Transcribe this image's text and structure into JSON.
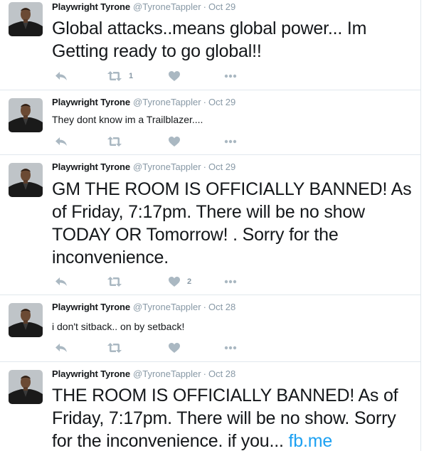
{
  "colors": {
    "name": "#14171a",
    "meta": "#8899a6",
    "icon": "#aab8c2",
    "link": "#1da1f2",
    "divider": "#e1e8ed"
  },
  "tweets": [
    {
      "name": "Playwright Tyrone",
      "handle": "@TyroneTappler",
      "separator": "·",
      "time": "Oct 29",
      "text": "Global attacks..means global power... Im Getting ready to go global!!",
      "link": "",
      "retweets": "1",
      "likes": ""
    },
    {
      "name": "Playwright Tyrone",
      "handle": "@TyroneTappler",
      "separator": "·",
      "time": "Oct 29",
      "text": "They dont know im a Trailblazer....",
      "link": "",
      "retweets": "",
      "likes": ""
    },
    {
      "name": "Playwright Tyrone",
      "handle": "@TyroneTappler",
      "separator": "·",
      "time": "Oct 29",
      "text": "GM THE ROOM IS OFFICIALLY BANNED! As of Friday, 7:17pm. There will be no show TODAY OR Tomorrow! . Sorry for the inconvenience.",
      "link": "",
      "retweets": "",
      "likes": "2"
    },
    {
      "name": "Playwright Tyrone",
      "handle": "@TyroneTappler",
      "separator": "·",
      "time": "Oct 28",
      "text": "i don't sitback.. on by setback!",
      "link": "",
      "retweets": "",
      "likes": ""
    },
    {
      "name": "Playwright Tyrone",
      "handle": "@TyroneTappler",
      "separator": "·",
      "time": "Oct 28",
      "text": "THE ROOM IS OFFICIALLY BANNED! As of Friday, 7:17pm. There will be no show. Sorry for the inconvenience. if you... ",
      "link": "fb.me",
      "retweets": "",
      "likes": ""
    }
  ],
  "icons": {
    "reply": "reply-icon",
    "retweet": "retweet-icon",
    "like": "heart-icon",
    "more": "more-dots-icon"
  }
}
